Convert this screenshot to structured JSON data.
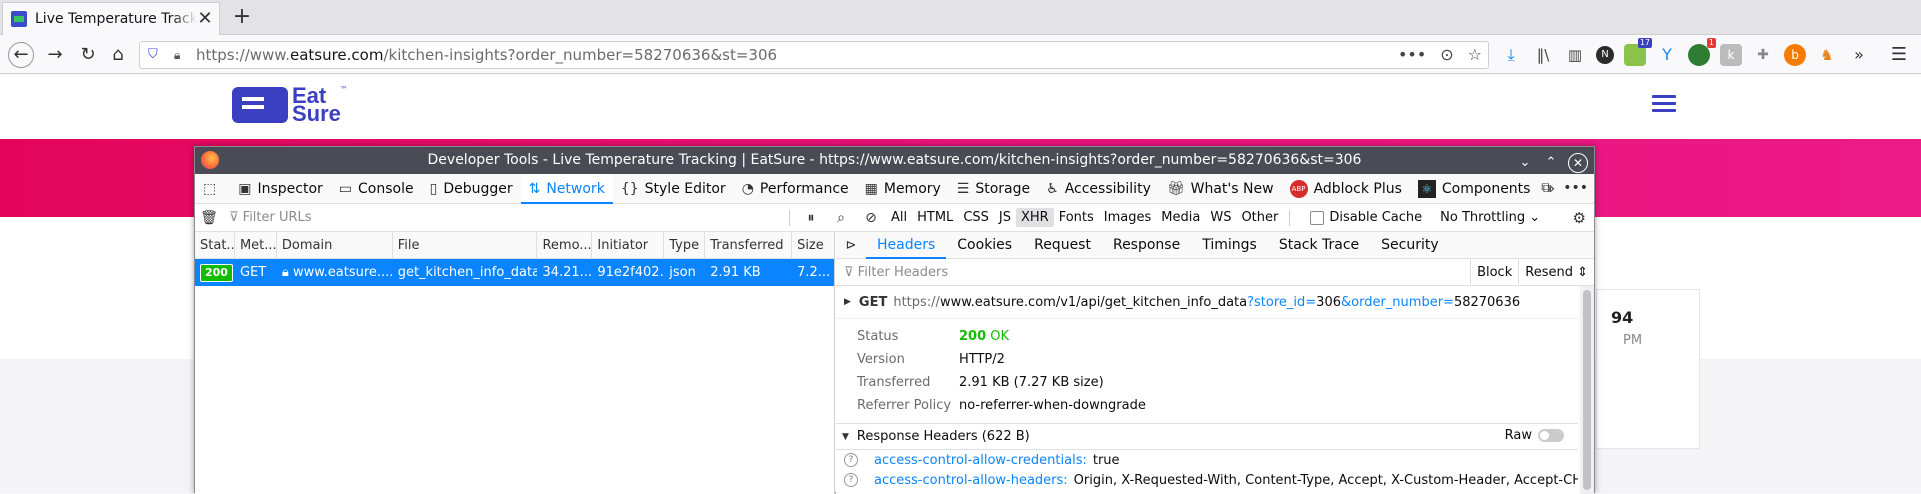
{
  "browser": {
    "tab_title": "Live Temperature Tracking | EatSure",
    "tab_close": "✕",
    "new_tab": "+",
    "url_prefix": "https://www.",
    "url_host": "eatsure.com",
    "url_path": "/kitchen-insights?order_number=58270636&st=306",
    "page_actions": [
      "•••",
      "⊙",
      "☆"
    ],
    "ext_badges": [
      "17",
      "1"
    ],
    "ext_letters": [
      "N"
    ]
  },
  "page": {
    "logo_line1": "Eat",
    "logo_line2": "Sure",
    "logo_tm": "™",
    "card_big": "94",
    "card_small": "PM"
  },
  "devtools": {
    "window_title": "Developer Tools - Live Temperature Tracking | EatSure - https://www.eatsure.com/kitchen-insights?order_number=58270636&st=306",
    "tabs": [
      "Inspector",
      "Console",
      "Debugger",
      "Network",
      "Style Editor",
      "Performance",
      "Memory",
      "Storage",
      "Accessibility",
      "What's New",
      "Adblock Plus",
      "Components"
    ],
    "active_tab": "Network",
    "abp_badge": "ABP",
    "filter_placeholder": "Filter URLs",
    "type_filters": [
      "All",
      "HTML",
      "CSS",
      "JS",
      "XHR",
      "Fonts",
      "Images",
      "Media",
      "WS",
      "Other"
    ],
    "active_filter": "XHR",
    "disable_cache": "Disable Cache",
    "throttling": "No Throttling",
    "columns": [
      "Stat...",
      "Met...",
      "Domain",
      "File",
      "Remo...",
      "Initiator",
      "Type",
      "Transferred",
      "Size"
    ],
    "request": {
      "status": "200",
      "method": "GET",
      "domain": "www.eatsure....",
      "file": "get_kitchen_info_data...",
      "remote": "34.21...",
      "initiator": "91e2f402...",
      "type": "json",
      "transferred": "2.91 KB",
      "size": "7.2..."
    },
    "detail_tabs": [
      "Headers",
      "Cookies",
      "Request",
      "Response",
      "Timings",
      "Stack Trace",
      "Security"
    ],
    "active_detail_tab": "Headers",
    "filter_headers_placeholder": "Filter Headers",
    "block_label": "Block",
    "resend_label": "Resend",
    "summary": {
      "method": "GET",
      "url_prefix": "https://",
      "url_main": "www.eatsure.com/v1/api/get_kitchen_info_data",
      "q1_key": "?store_id=",
      "q1_val": "306",
      "q2_key": "&order_number=",
      "q2_val": "58270636"
    },
    "general": {
      "status_label": "Status",
      "status_code": "200",
      "status_text": "OK",
      "version_label": "Version",
      "version_value": "HTTP/2",
      "transferred_label": "Transferred",
      "transferred_value": "2.91 KB (7.27 KB size)",
      "referrer_label": "Referrer Policy",
      "referrer_value": "no-referrer-when-downgrade"
    },
    "response_headers_title": "Response Headers (622 B)",
    "raw_label": "Raw",
    "response_headers": [
      {
        "key": "access-control-allow-credentials:",
        "value": "true"
      },
      {
        "key": "access-control-allow-headers:",
        "value": "Origin, X-Requested-With, Content-Type, Accept, X-Custom-Header, Accept-CH, DPR, Downlink, Vi"
      }
    ]
  },
  "colors": {
    "accent": "#0a84ff",
    "status_ok": "#12bc00",
    "brand": "#3b3fc1",
    "banner": "#e9127a"
  }
}
